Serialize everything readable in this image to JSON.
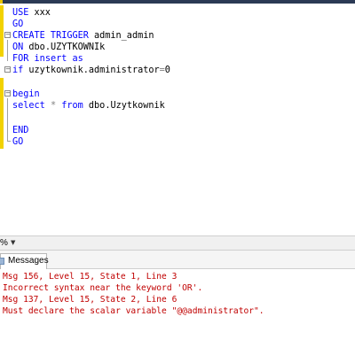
{
  "editor": {
    "lines": [
      {
        "id": "use",
        "parts": [
          {
            "t": "USE",
            "c": "kw"
          },
          {
            "t": " xxx",
            "c": ""
          }
        ]
      },
      {
        "id": "go1",
        "parts": [
          {
            "t": "GO",
            "c": "kw"
          }
        ]
      },
      {
        "id": "create",
        "parts": [
          {
            "t": "CREATE TRIGGER",
            "c": "kw"
          },
          {
            "t": " admin_admin",
            "c": ""
          }
        ]
      },
      {
        "id": "on",
        "parts": [
          {
            "t": "ON",
            "c": "kw"
          },
          {
            "t": " dbo.UZYTKOWNIk",
            "c": ""
          }
        ]
      },
      {
        "id": "for",
        "parts": [
          {
            "t": "FOR",
            "c": "kw"
          },
          {
            "t": " ",
            "c": ""
          },
          {
            "t": "insert",
            "c": "kw"
          },
          {
            "t": " ",
            "c": ""
          },
          {
            "t": "as",
            "c": "kw"
          }
        ]
      },
      {
        "id": "if",
        "parts": [
          {
            "t": "if",
            "c": "kw"
          },
          {
            "t": " uzytkownik.administrator",
            "c": ""
          },
          {
            "t": "=",
            "c": "gray"
          },
          {
            "t": "0",
            "c": ""
          }
        ]
      },
      {
        "id": "blank1",
        "parts": []
      },
      {
        "id": "begin",
        "parts": [
          {
            "t": "begin",
            "c": "kw"
          }
        ]
      },
      {
        "id": "select",
        "parts": [
          {
            "t": "select",
            "c": "kw"
          },
          {
            "t": " ",
            "c": ""
          },
          {
            "t": "*",
            "c": "gray"
          },
          {
            "t": " ",
            "c": ""
          },
          {
            "t": "from",
            "c": "kw"
          },
          {
            "t": " dbo.Uzytkownik",
            "c": ""
          }
        ]
      },
      {
        "id": "blank2",
        "parts": []
      },
      {
        "id": "end",
        "parts": [
          {
            "t": "END",
            "c": "kw"
          }
        ]
      },
      {
        "id": "go2",
        "parts": [
          {
            "t": "GO",
            "c": "kw"
          }
        ]
      }
    ]
  },
  "zoom": {
    "value": "%"
  },
  "results": {
    "tab_label": "Messages",
    "messages": [
      "Msg 156, Level 15, State 1, Line 3",
      "Incorrect syntax near the keyword 'OR'.",
      "Msg 137, Level 15, State 2, Line 6",
      "Must declare the scalar variable \"@@administrator\"."
    ]
  },
  "colors": {
    "keyword": "#0000ff",
    "operator": "#808080",
    "error_text": "#c00000",
    "change_marker": "#f2d200"
  },
  "icons": {
    "fold_marker": "collapse-minus-icon",
    "zoom_dropdown": "chevron-down-icon",
    "messages_tab": "messages-icon"
  }
}
